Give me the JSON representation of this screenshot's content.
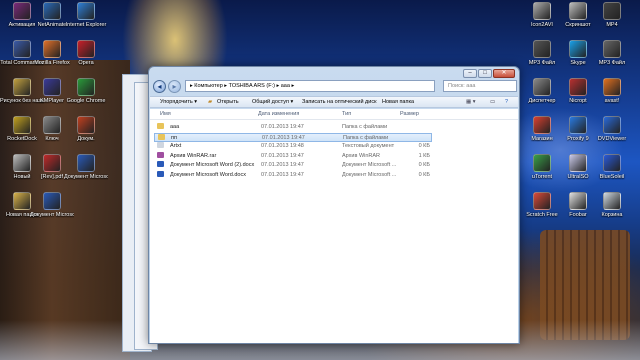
{
  "desktop_icons_left": [
    {
      "label": "Активация",
      "color": "#7a2a7a"
    },
    {
      "label": "NetAnimate",
      "color": "#2a6ab8"
    },
    {
      "label": "Internet Explorer",
      "color": "#2f7fd6"
    },
    {
      "label": "Total Commander",
      "color": "#3a5aa8"
    },
    {
      "label": "Mozilla Firefox",
      "color": "#e0702a"
    },
    {
      "label": "Opera",
      "color": "#c8202a"
    },
    {
      "label": "Рисунок без назв.",
      "color": "#c0a040"
    },
    {
      "label": "KMPlayer",
      "color": "#3a3a9a"
    },
    {
      "label": "Google Chrome",
      "color": "#2a9a3a"
    },
    {
      "label": "RocketDock",
      "color": "#c0a020"
    },
    {
      "label": "Ключ",
      "color": "#888"
    },
    {
      "label": "Докум.",
      "color": "#c04020"
    },
    {
      "label": "Новый",
      "color": "#bbb"
    },
    {
      "label": "[Rev].pdf",
      "color": "#c02a2a"
    },
    {
      "label": "Документ Microsoft W",
      "color": "#2a5ab8"
    },
    {
      "label": "Новая папка",
      "color": "#d8b24a"
    },
    {
      "label": "Документ Microsoft",
      "color": "#2a5ab8"
    }
  ],
  "desktop_icons_right": [
    {
      "label": "Icon2AVI",
      "color": "#aaa"
    },
    {
      "label": "Скриншот",
      "color": "#bbb"
    },
    {
      "label": "MP4",
      "color": "#444"
    },
    {
      "label": "MP3 Файл",
      "color": "#555"
    },
    {
      "label": "Skype",
      "color": "#1aa0e8"
    },
    {
      "label": "MP3 Файл",
      "color": "#666"
    },
    {
      "label": "Диспетчер",
      "color": "#888"
    },
    {
      "label": "Nicropt",
      "color": "#b83030"
    },
    {
      "label": "avast!",
      "color": "#e07020"
    },
    {
      "label": "Магазин",
      "color": "#d84030"
    },
    {
      "label": "Proxify 9",
      "color": "#2a7ae0"
    },
    {
      "label": "DVDViewer",
      "color": "#2a6ad8"
    },
    {
      "label": "uTorrent",
      "color": "#3aa048"
    },
    {
      "label": "UltraISO",
      "color": "#c8c8e8"
    },
    {
      "label": "BlueSoleil",
      "color": "#2a5ad8"
    },
    {
      "label": "Scratch Free",
      "color": "#d84a3a"
    },
    {
      "label": "Foobar",
      "color": "#ddd"
    },
    {
      "label": "Корзина",
      "color": "#cfd8e0"
    }
  ],
  "explorer": {
    "breadcrumb": "▸ Компьютер ▸ TOSHIBA ARS (F:) ▸ ааа ▸",
    "search_placeholder": "Поиск: ааа",
    "toolbar": {
      "organize": "Упорядочить ▾",
      "open": "Открыть",
      "share": "Общий доступ ▾",
      "burn": "Записать на оптический диск",
      "new_folder": "Новая папка"
    },
    "columns": {
      "name": "Имя",
      "date": "Дата изменения",
      "type": "Тип",
      "size": "Размер"
    },
    "files": [
      {
        "name": "ааа",
        "date": "07.01.2013 19:47",
        "type": "Папка с файлами",
        "size": "",
        "icon_color": "#e8c45a",
        "selected": false
      },
      {
        "name": "пп",
        "date": "07.01.2013 19:47",
        "type": "Папка с файлами",
        "size": "",
        "icon_color": "#e8c45a",
        "selected": true
      },
      {
        "name": "Artxt",
        "date": "07.01.2013 19:48",
        "type": "Текстовый документ",
        "size": "0 КБ",
        "icon_color": "#cfd6e0",
        "selected": false
      },
      {
        "name": "Архив WinRAR.rar",
        "date": "07.01.2013 19:47",
        "type": "Архив WinRAR",
        "size": "1 КБ",
        "icon_color": "#a04fa0",
        "selected": false
      },
      {
        "name": "Документ Microsoft Word (2).docx",
        "date": "07.01.2013 19:47",
        "type": "Документ Microsoft ...",
        "size": "0 КБ",
        "icon_color": "#2a5ab8",
        "selected": false
      },
      {
        "name": "Документ Microsoft Word.docx",
        "date": "07.01.2013 19:47",
        "type": "Документ Microsoft ...",
        "size": "0 КБ",
        "icon_color": "#2a5ab8",
        "selected": false
      }
    ]
  }
}
